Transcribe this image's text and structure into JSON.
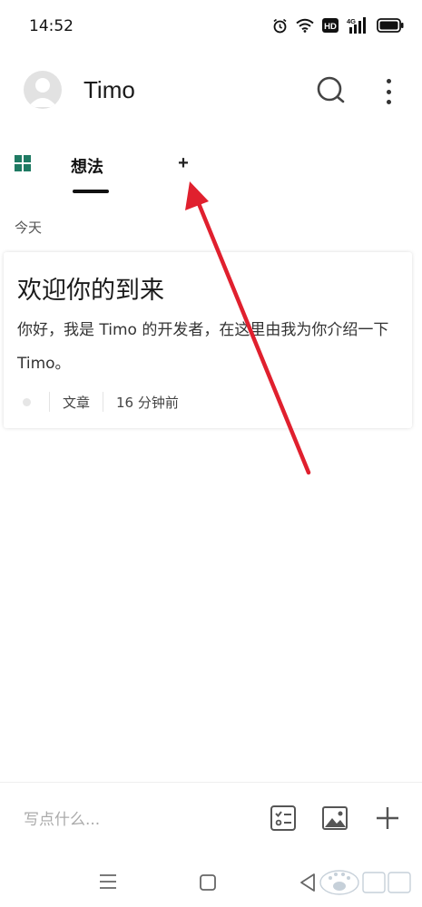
{
  "status_bar": {
    "time": "14:52",
    "icons": [
      "alarm-icon",
      "wifi-icon",
      "hd-icon",
      "4g-signal-icon",
      "battery-icon"
    ],
    "hd_label": "HD",
    "network_label": "4G"
  },
  "header": {
    "title": "Timo",
    "icons": [
      "avatar",
      "search-icon",
      "more-vertical-icon"
    ]
  },
  "tabs": {
    "grid_icon": "grid-icon",
    "items": [
      {
        "label": "想法",
        "active": true
      }
    ],
    "add_label": "+"
  },
  "timeline": {
    "section_label": "今天",
    "notes": [
      {
        "title": "欢迎你的到来",
        "body": "你好，我是 Timo 的开发者，在这里由我为你介绍一下 Timo。",
        "category": "文章",
        "time": "16 分钟前"
      }
    ]
  },
  "compose": {
    "placeholder": "写点什么...",
    "icons": [
      "checklist-icon",
      "image-icon",
      "plus-icon"
    ]
  },
  "nav_bar": {
    "icons": [
      "menu-icon",
      "home-icon",
      "back-icon"
    ]
  },
  "colors": {
    "accent_green": "#1f7a63",
    "annotation_arrow": "#e0202e",
    "text_primary": "#1a1a1a",
    "text_secondary": "#555555"
  }
}
